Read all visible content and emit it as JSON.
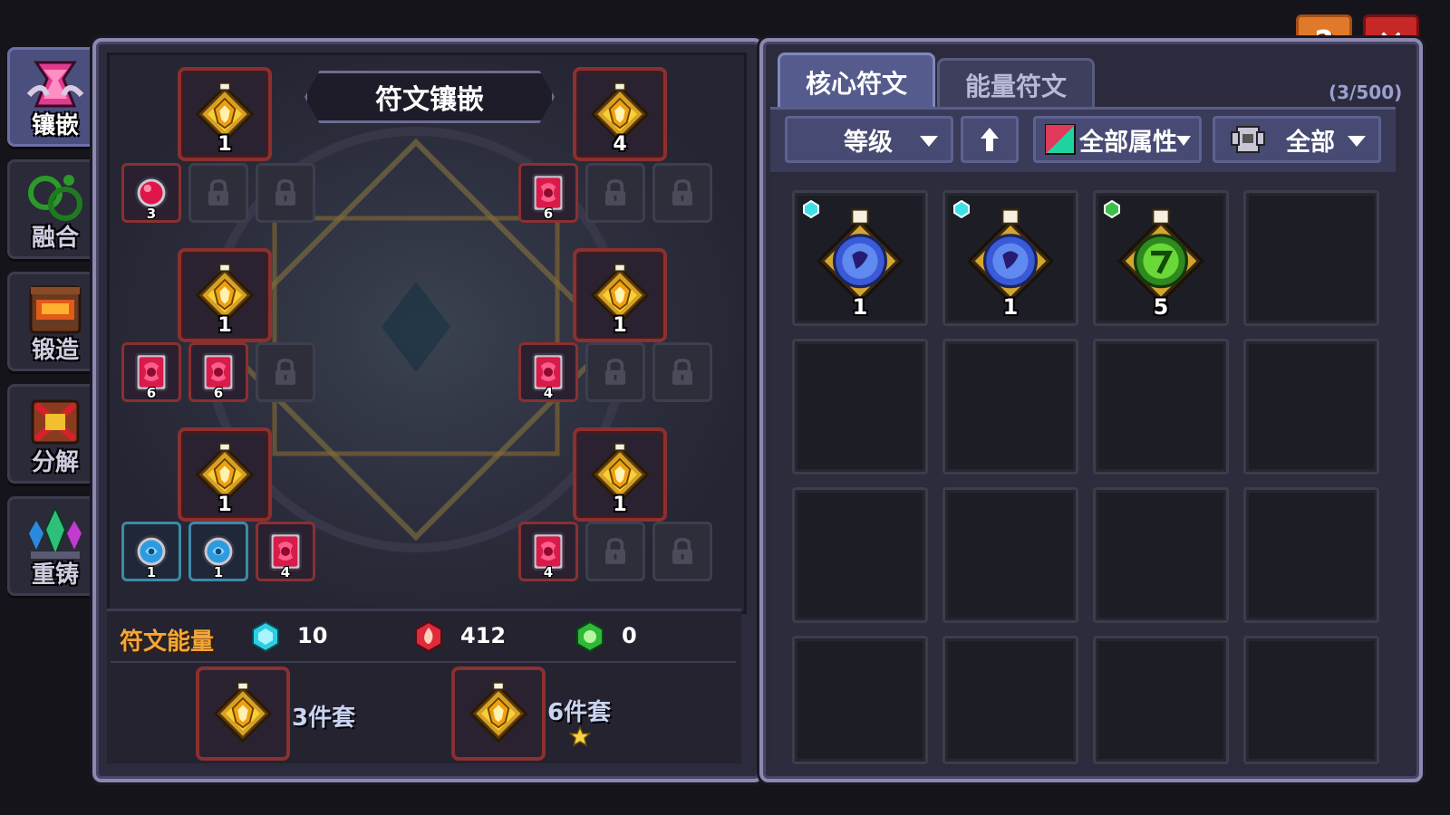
{
  "sidebar": {
    "items": [
      {
        "label": "镶嵌",
        "icon": "inlay-icon",
        "active": true
      },
      {
        "label": "融合",
        "icon": "fuse-icon",
        "active": false
      },
      {
        "label": "锻造",
        "icon": "forge-icon",
        "active": false
      },
      {
        "label": "分解",
        "icon": "decompose-icon",
        "active": false
      },
      {
        "label": "重铸",
        "icon": "recast-icon",
        "active": false
      }
    ]
  },
  "left_panel": {
    "title": "符文镶嵌",
    "core_slot_levels": [
      "1",
      "4",
      "1",
      "1",
      "1",
      "1"
    ],
    "left_rows": [
      {
        "small": [
          {
            "kind": "red-gem",
            "num": "3"
          },
          {
            "kind": "locked"
          },
          {
            "kind": "locked"
          }
        ]
      },
      {
        "small": [
          {
            "kind": "red-rune",
            "num": "6"
          },
          {
            "kind": "red-rune",
            "num": "6"
          },
          {
            "kind": "locked"
          }
        ]
      },
      {
        "small": [
          {
            "kind": "blue-gem",
            "num": "1"
          },
          {
            "kind": "blue-gem",
            "num": "1"
          },
          {
            "kind": "red-rune",
            "num": "4"
          }
        ]
      }
    ],
    "right_rows": [
      {
        "small": [
          {
            "kind": "red-rune",
            "num": "6"
          },
          {
            "kind": "locked"
          },
          {
            "kind": "locked"
          }
        ]
      },
      {
        "small": [
          {
            "kind": "red-rune",
            "num": "4"
          },
          {
            "kind": "locked"
          },
          {
            "kind": "locked"
          }
        ]
      },
      {
        "small": [
          {
            "kind": "red-rune",
            "num": "4"
          },
          {
            "kind": "locked"
          },
          {
            "kind": "locked"
          }
        ]
      }
    ],
    "energy": {
      "label": "符文能量",
      "blue": "10",
      "red": "412",
      "green": "0"
    },
    "sets": [
      {
        "label": "3件套",
        "star": false
      },
      {
        "label": "6件套",
        "star": true
      }
    ]
  },
  "right_panel": {
    "tabs": [
      {
        "label": "核心符文",
        "active": true
      },
      {
        "label": "能量符文",
        "active": false
      }
    ],
    "count": "(3/500)",
    "filters": {
      "sort_label": "等级",
      "attr_label": "全部属性",
      "type_label": "全部"
    },
    "inventory": [
      {
        "gem": "blue",
        "level": "1",
        "dot": "cyan"
      },
      {
        "gem": "blue",
        "level": "1",
        "dot": "cyan"
      },
      {
        "gem": "green",
        "level": "5",
        "dot": "green"
      }
    ]
  },
  "top_buttons": {
    "help": "?",
    "close": "✕"
  },
  "colors": {
    "accent_orange": "#f3a63a",
    "slot_red": "#8a3030",
    "slot_blue": "#3d8aa8",
    "panel_purple": "#555b8c",
    "close_red": "#c62828",
    "help_orange": "#e07a2a"
  }
}
